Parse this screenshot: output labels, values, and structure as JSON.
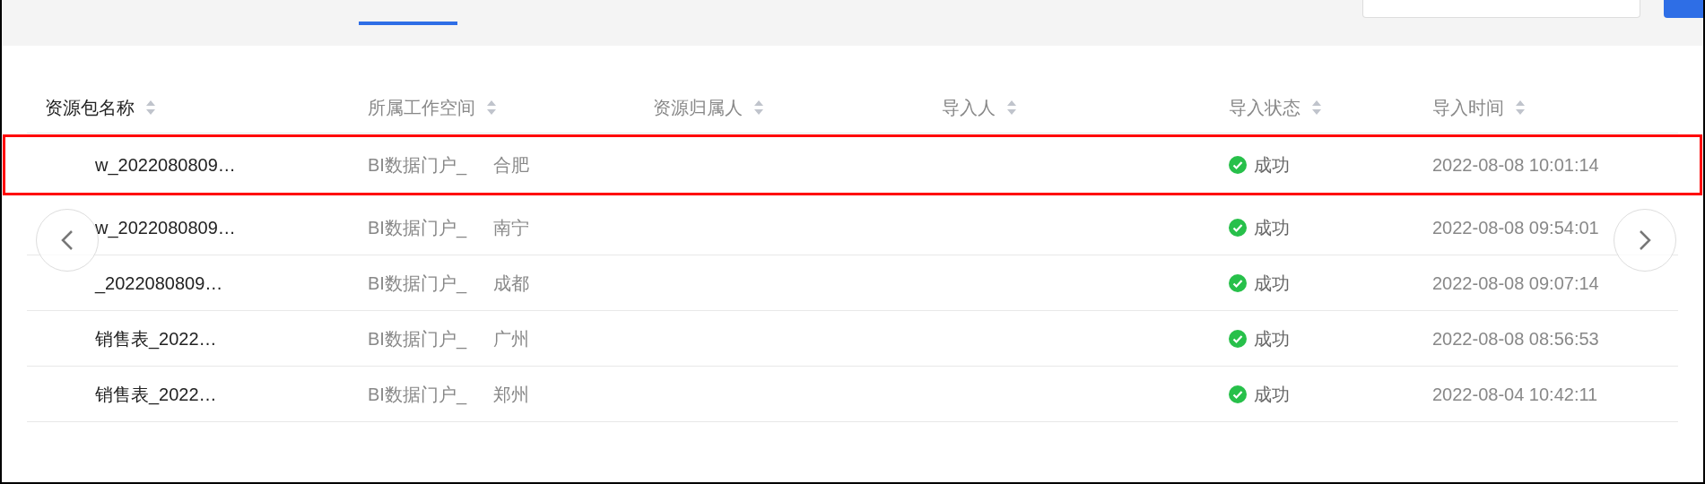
{
  "table": {
    "columns": [
      "资源包名称",
      "所属工作空间",
      "资源归属人",
      "导入人",
      "导入状态",
      "导入时间"
    ],
    "rows": [
      {
        "name": "w_2022080809…",
        "workspace": "BI数据门户_",
        "city": "合肥",
        "status": "成功",
        "time": "2022-08-08 10:01:14",
        "highlighted": true
      },
      {
        "name": "w_2022080809…",
        "workspace": "BI数据门户_",
        "city": "南宁",
        "status": "成功",
        "time": "2022-08-08 09:54:01",
        "highlighted": false
      },
      {
        "name": "_2022080809…",
        "workspace": "BI数据门户_",
        "city": "成都",
        "status": "成功",
        "time": "2022-08-08 09:07:14",
        "highlighted": false
      },
      {
        "name": "销售表_2022…",
        "workspace": "BI数据门户_",
        "city": "广州",
        "status": "成功",
        "time": "2022-08-08 08:56:53",
        "highlighted": false
      },
      {
        "name": "销售表_2022…",
        "workspace": "BI数据门户_",
        "city": "郑州",
        "status": "成功",
        "time": "2022-08-04 10:42:11",
        "highlighted": false
      }
    ]
  }
}
